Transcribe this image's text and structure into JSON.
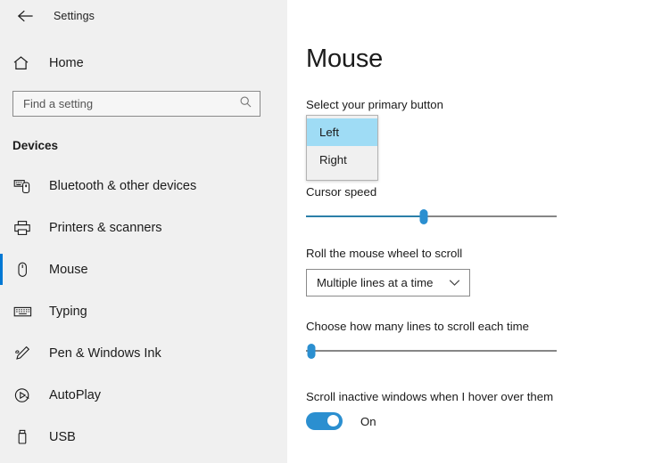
{
  "window": {
    "back_icon": "back-arrow-icon",
    "title": "Settings"
  },
  "sidebar": {
    "home": {
      "label": "Home",
      "icon": "home-icon"
    },
    "search": {
      "placeholder": "Find a setting",
      "value": "",
      "icon": "search-icon"
    },
    "section_header": "Devices",
    "accent_color": "#0078d4",
    "items": [
      {
        "label": "Bluetooth & other devices",
        "icon": "bluetooth-devices-icon",
        "selected": false
      },
      {
        "label": "Printers & scanners",
        "icon": "printer-icon",
        "selected": false
      },
      {
        "label": "Mouse",
        "icon": "mouse-icon",
        "selected": true
      },
      {
        "label": "Typing",
        "icon": "keyboard-icon",
        "selected": false
      },
      {
        "label": "Pen & Windows Ink",
        "icon": "pen-icon",
        "selected": false
      },
      {
        "label": "AutoPlay",
        "icon": "autoplay-icon",
        "selected": false
      },
      {
        "label": "USB",
        "icon": "usb-icon",
        "selected": false
      }
    ]
  },
  "main": {
    "title": "Mouse",
    "primary_button": {
      "label": "Select your primary button",
      "selected_value": "Left",
      "expanded": true,
      "options": [
        {
          "label": "Left",
          "highlighted": true
        },
        {
          "label": "Right",
          "highlighted": false
        }
      ]
    },
    "cursor_speed": {
      "label": "Cursor speed",
      "percent": 47
    },
    "wheel_scroll": {
      "label": "Roll the mouse wheel to scroll",
      "value": "Multiple lines at a time",
      "chevron_icon": "chevron-down-icon"
    },
    "lines_to_scroll": {
      "label": "Choose how many lines to scroll each time",
      "percent": 2
    },
    "inactive_scroll": {
      "label": "Scroll inactive windows when I hover over them",
      "state": "On",
      "on": true
    },
    "accent_color": "#2b8fd0"
  }
}
